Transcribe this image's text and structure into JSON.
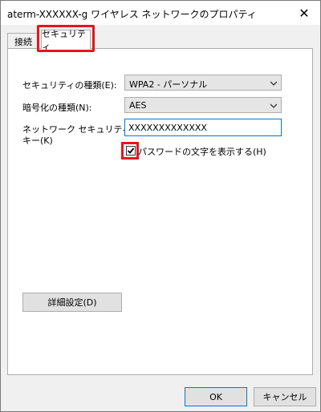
{
  "window": {
    "title": "aterm-XXXXXX-g ワイヤレス ネットワークのプロパティ",
    "close_glyph": "✕"
  },
  "tabs": [
    {
      "label": "接続",
      "selected": false
    },
    {
      "label": "セキュリティ",
      "selected": true
    }
  ],
  "form": {
    "security_type_label": "セキュリティの種類(E):",
    "security_type_value": "WPA2 - パーソナル",
    "encryption_label": "暗号化の種類(N):",
    "encryption_value": "AES",
    "key_label_line1": "ネットワーク セキュリティ",
    "key_label_line2": "キー(K)",
    "key_value": "XXXXXXXXXXXXX",
    "show_chars_label": "パスワードの文字を表示する(H)",
    "show_chars_checked": true
  },
  "buttons": {
    "advanced": "詳細設定(D)",
    "ok": "OK",
    "cancel": "キャンセル"
  },
  "colors": {
    "highlight": "#e8141c",
    "focus": "#0078d7"
  }
}
